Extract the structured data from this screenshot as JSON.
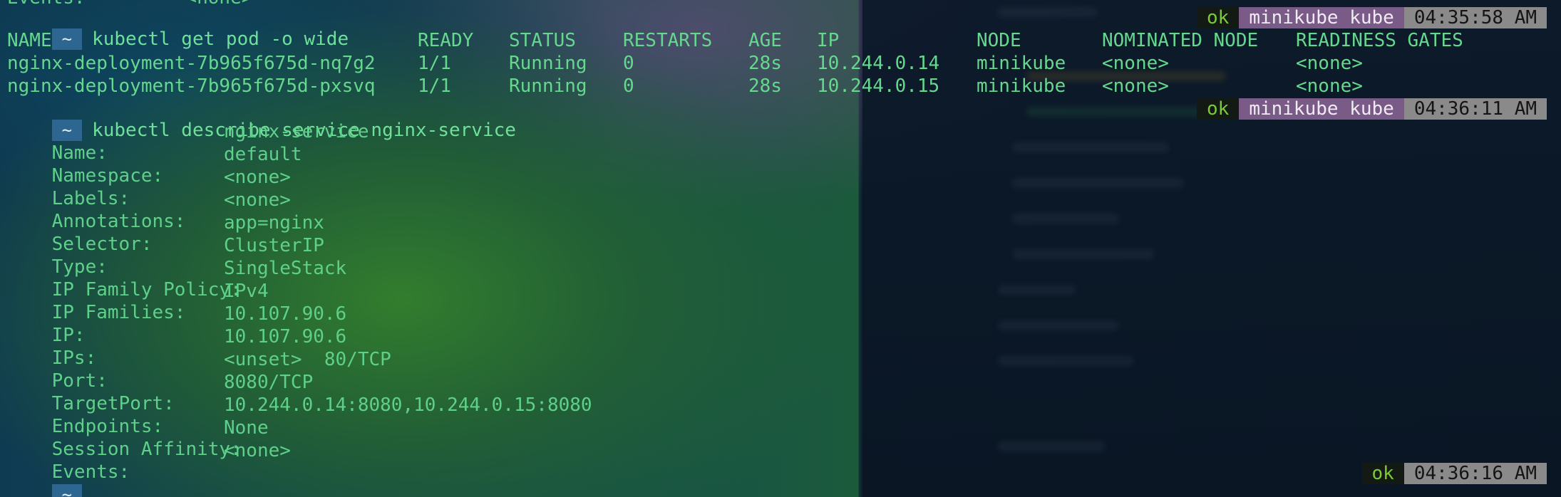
{
  "terminal": {
    "top_partial": "Events:         <none>",
    "prompt_symbol": "~",
    "command1": "kubectl get pod -o wide",
    "status1": {
      "ok": "ok",
      "context": "minikube kube",
      "time": "04:35:58 AM"
    },
    "pods_table": {
      "headers": [
        "NAME",
        "READY",
        "STATUS",
        "RESTARTS",
        "AGE",
        "IP",
        "NODE",
        "NOMINATED NODE",
        "READINESS GATES"
      ],
      "rows": [
        [
          "nginx-deployment-7b965f675d-nq7g2",
          "1/1",
          "Running",
          "0",
          "28s",
          "10.244.0.14",
          "minikube",
          "<none>",
          "<none>"
        ],
        [
          "nginx-deployment-7b965f675d-pxsvq",
          "1/1",
          "Running",
          "0",
          "28s",
          "10.244.0.15",
          "minikube",
          "<none>",
          "<none>"
        ]
      ]
    },
    "command2": "kubectl describe service nginx-service",
    "status2": {
      "ok": "ok",
      "context": "minikube kube",
      "time": "04:36:11 AM"
    },
    "describe": [
      {
        "key": "Name:",
        "value": "nginx-service"
      },
      {
        "key": "Namespace:",
        "value": "default"
      },
      {
        "key": "Labels:",
        "value": "<none>"
      },
      {
        "key": "Annotations:",
        "value": "<none>"
      },
      {
        "key": "Selector:",
        "value": "app=nginx"
      },
      {
        "key": "Type:",
        "value": "ClusterIP"
      },
      {
        "key": "IP Family Policy:",
        "value": "SingleStack"
      },
      {
        "key": "IP Families:",
        "value": "IPv4"
      },
      {
        "key": "IP:",
        "value": "10.107.90.6"
      },
      {
        "key": "IPs:",
        "value": "10.107.90.6"
      },
      {
        "key": "Port:",
        "value": "<unset>  80/TCP"
      },
      {
        "key": "TargetPort:",
        "value": "8080/TCP"
      },
      {
        "key": "Endpoints:",
        "value": "10.244.0.14:8080,10.244.0.15:8080"
      },
      {
        "key": "Session Affinity:",
        "value": "None"
      },
      {
        "key": "Events:",
        "value": "<none>"
      }
    ],
    "status3": {
      "ok": "ok",
      "time": "04:36:16 AM"
    }
  }
}
